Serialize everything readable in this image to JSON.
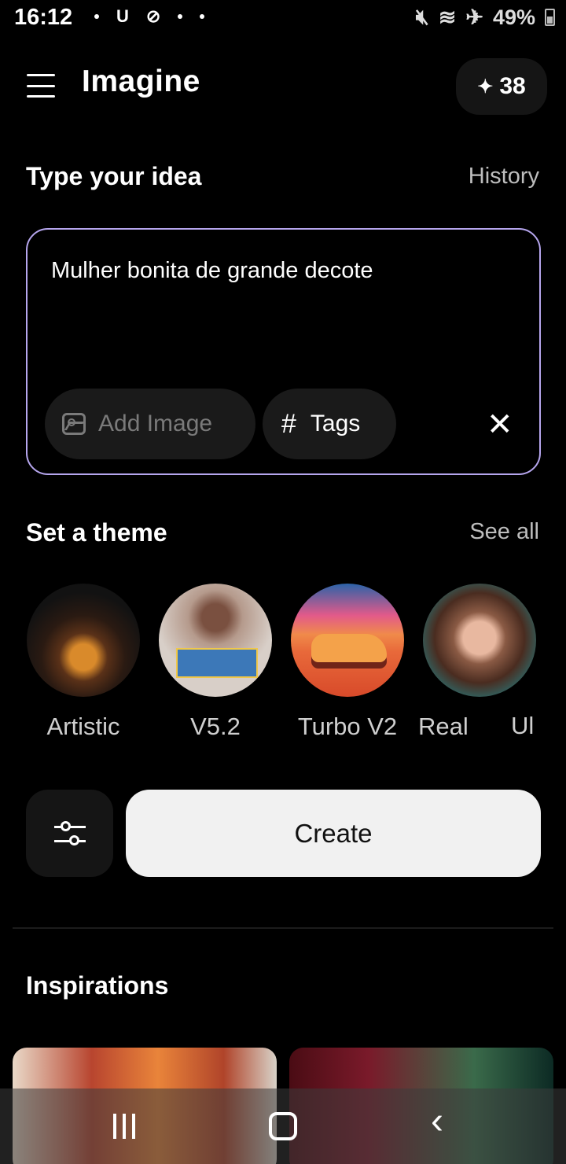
{
  "status_bar": {
    "time": "16:12",
    "left_icons": [
      "U"
    ],
    "battery": "49%"
  },
  "header": {
    "title": "Imagine",
    "credits": "38"
  },
  "idea": {
    "title": "Type your idea",
    "history_label": "History",
    "prompt_text": "Mulher bonita de grande decote",
    "add_image_label": "Add Image",
    "tags_label": "Tags"
  },
  "theme": {
    "title": "Set a theme",
    "see_all_label": "See all",
    "items": [
      {
        "label": "Artistic"
      },
      {
        "label": "V5.2"
      },
      {
        "label": "Turbo V2"
      },
      {
        "label": "Real"
      },
      {
        "label": "Ul"
      }
    ]
  },
  "create": {
    "label": "Create"
  },
  "inspirations": {
    "title": "Inspirations"
  },
  "colors": {
    "accent_border": "#b6a6ee",
    "background": "#000000",
    "create_button": "#f1f1f1"
  }
}
